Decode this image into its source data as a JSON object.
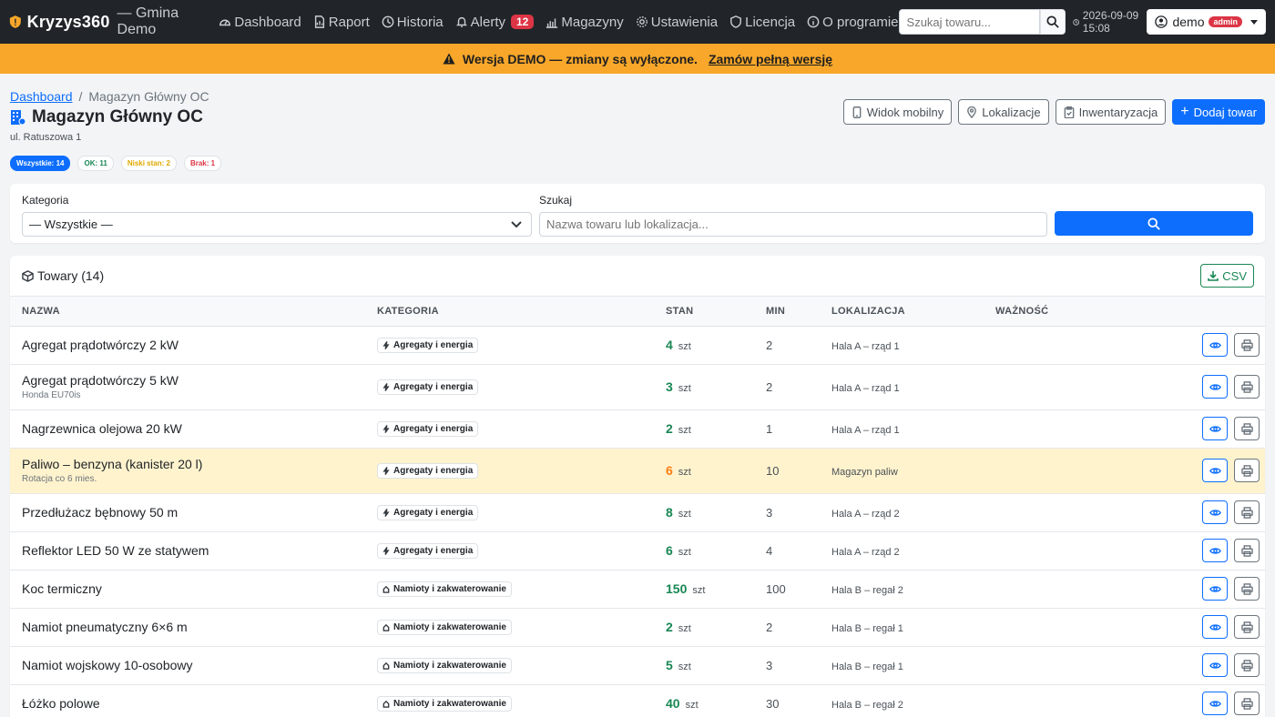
{
  "navbar": {
    "brand_name": "Kryzys360",
    "brand_sub": "— Gmina Demo",
    "items": [
      {
        "label": "Dashboard",
        "icon": "speedometer-icon"
      },
      {
        "label": "Raport",
        "icon": "report-icon"
      },
      {
        "label": "Historia",
        "icon": "clock-icon"
      },
      {
        "label": "Alerty",
        "icon": "bell-icon",
        "badge": "12"
      },
      {
        "label": "Magazyny",
        "icon": "warehouse-icon"
      },
      {
        "label": "Ustawienia",
        "icon": "gear-icon"
      },
      {
        "label": "Licencja",
        "icon": "shield-icon"
      },
      {
        "label": "O programie",
        "icon": "info-icon"
      }
    ],
    "search_placeholder": "Szukaj towaru...",
    "datetime": "2026-09-09 15:08",
    "user": "demo",
    "role_badge": "admin"
  },
  "banner": {
    "text": "Wersja DEMO — zmiany są wyłączone.",
    "link": "Zamów pełną wersję",
    "color": "#f8a72a"
  },
  "breadcrumb": {
    "home": "Dashboard",
    "current": "Magazyn Główny OC"
  },
  "page": {
    "title": "Magazyn Główny OC",
    "address": "ul. Ratuszowa 1"
  },
  "actions": {
    "mobile": "Widok mobilny",
    "locations": "Lokalizacje",
    "inventory": "Inwentaryzacja",
    "add": "Dodaj towar"
  },
  "filters": {
    "all": "Wszystkie: 14",
    "ok": "OK: 11",
    "low": "Niski stan: 2",
    "none": "Brak: 1"
  },
  "search_form": {
    "category_label": "Kategoria",
    "category_value": "— Wszystkie —",
    "search_label": "Szukaj",
    "search_placeholder": "Nazwa towaru lub lokalizacja..."
  },
  "table": {
    "title": "Towary (14)",
    "csv": "CSV",
    "headers": {
      "name": "NAZWA",
      "category": "KATEGORIA",
      "stan": "STAN",
      "min": "MIN",
      "location": "LOKALIZACJA",
      "validity": "WAŻNOŚĆ"
    },
    "rows": [
      {
        "name": "Agregat prądotwórczy 2 kW",
        "note": "",
        "category": "Agregaty i energia",
        "cat_icon": "lightning-icon",
        "stan": "4",
        "unit": "szt",
        "min": "2",
        "location": "Hala A – rząd 1",
        "status": "ok"
      },
      {
        "name": "Agregat prądotwórczy 5 kW",
        "note": "Honda EU70is",
        "category": "Agregaty i energia",
        "cat_icon": "lightning-icon",
        "stan": "3",
        "unit": "szt",
        "min": "2",
        "location": "Hala A – rząd 1",
        "status": "ok"
      },
      {
        "name": "Nagrzewnica olejowa 20 kW",
        "note": "",
        "category": "Agregaty i energia",
        "cat_icon": "lightning-icon",
        "stan": "2",
        "unit": "szt",
        "min": "1",
        "location": "Hala A – rząd 1",
        "status": "ok"
      },
      {
        "name": "Paliwo – benzyna (kanister 20 l)",
        "note": "Rotacja co 6 mies.",
        "category": "Agregaty i energia",
        "cat_icon": "lightning-icon",
        "stan": "6",
        "unit": "szt",
        "min": "10",
        "location": "Magazyn paliw",
        "status": "low"
      },
      {
        "name": "Przedłużacz bębnowy 50 m",
        "note": "",
        "category": "Agregaty i energia",
        "cat_icon": "lightning-icon",
        "stan": "8",
        "unit": "szt",
        "min": "3",
        "location": "Hala A – rząd 2",
        "status": "ok"
      },
      {
        "name": "Reflektor LED 50 W ze statywem",
        "note": "",
        "category": "Agregaty i energia",
        "cat_icon": "lightning-icon",
        "stan": "6",
        "unit": "szt",
        "min": "4",
        "location": "Hala A – rząd 2",
        "status": "ok"
      },
      {
        "name": "Koc termiczny",
        "note": "",
        "category": "Namioty i zakwaterowanie",
        "cat_icon": "house-icon",
        "stan": "150",
        "unit": "szt",
        "min": "100",
        "location": "Hala B – regał 2",
        "status": "ok"
      },
      {
        "name": "Namiot pneumatyczny 6×6 m",
        "note": "",
        "category": "Namioty i zakwaterowanie",
        "cat_icon": "house-icon",
        "stan": "2",
        "unit": "szt",
        "min": "2",
        "location": "Hala B – regał 1",
        "status": "ok"
      },
      {
        "name": "Namiot wojskowy 10-osobowy",
        "note": "",
        "category": "Namioty i zakwaterowanie",
        "cat_icon": "house-icon",
        "stan": "5",
        "unit": "szt",
        "min": "3",
        "location": "Hala B – regał 1",
        "status": "ok"
      },
      {
        "name": "Łóżko polowe",
        "note": "",
        "category": "Namioty i zakwaterowanie",
        "cat_icon": "house-icon",
        "stan": "40",
        "unit": "szt",
        "min": "30",
        "location": "Hala B – regał 2",
        "status": "ok"
      }
    ]
  }
}
